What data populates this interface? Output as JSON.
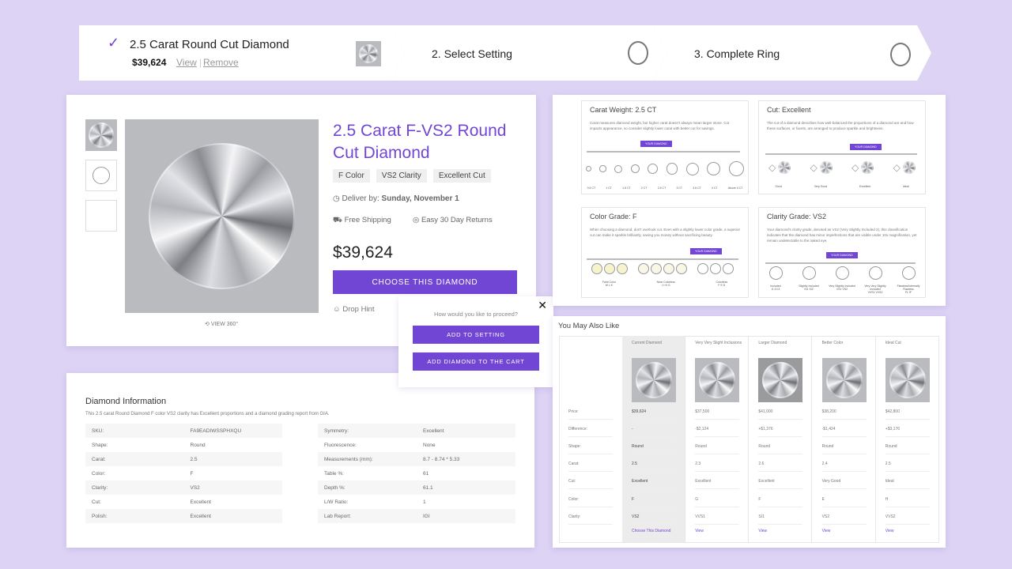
{
  "steps": [
    {
      "title": "2.5 Carat Round Cut Diamond",
      "price": "$39,624",
      "view": "View",
      "remove": "Remove",
      "icon": "check-icon"
    },
    {
      "title": "2. Select Setting",
      "icon": "ring-icon"
    },
    {
      "title": "3. Complete Ring",
      "icon": "diamond-ring-icon"
    }
  ],
  "product": {
    "title": "2.5 Carat F-VS2 Round Cut Diamond",
    "tags": [
      "F Color",
      "VS2 Clarity",
      "Excellent Cut"
    ],
    "deliver_label": "Deliver by:",
    "deliver_date": "Sunday, November 1",
    "shipping": "Free Shipping",
    "returns": "Easy 30 Day Returns",
    "price": "$39,624",
    "choose": "CHOOSE THIS DIAMOND",
    "drop_hint": "Drop Hint",
    "view360": "VIEW 360°",
    "accent": "#7246d4"
  },
  "popup": {
    "question": "How would you like to proceed?",
    "add_setting": "ADD TO SETTING",
    "add_cart": "ADD DIAMOND TO THE CART"
  },
  "info": {
    "title": "Diamond Information",
    "desc": "This 2.5 carat Round Diamond F color VS2 clarity has Excellent proportions and a diamond grading report from GIA.",
    "left": [
      [
        "SKU:",
        "FA9EADIWSSPHXQU"
      ],
      [
        "Shape:",
        "Round"
      ],
      [
        "Carat:",
        "2.5"
      ],
      [
        "Color:",
        "F"
      ],
      [
        "Clarity:",
        "VS2"
      ],
      [
        "Cut:",
        "Excellent"
      ],
      [
        "Polish:",
        "Excellent"
      ]
    ],
    "right": [
      [
        "Symmetry:",
        "Excellent"
      ],
      [
        "Fluorescence:",
        "None"
      ],
      [
        "Measurements (mm):",
        "8.7 - 8.74 * 5.33"
      ],
      [
        "Table %:",
        "61"
      ],
      [
        "Depth %:",
        "61.1"
      ],
      [
        "L/W Ratio:",
        "1"
      ],
      [
        "Lab Report:",
        "IGI"
      ]
    ]
  },
  "guides": {
    "your_diamond": "YOUR DIAMOND",
    "carat": {
      "title": "Carat Weight: 2.5 CT",
      "text": "Carat measures diamond weight, but higher carat doesn't always mean larger stone. Cut impacts appearance, so consider slightly lower carat with better cut for savings.",
      "labels": [
        "0.5 CT",
        "1 CT",
        "1.5 CT",
        "2 CT",
        "2.5 CT",
        "3 CT",
        "3.5 CT",
        "4 CT",
        "Above 4 CT"
      ]
    },
    "cut": {
      "title": "Cut: Excellent",
      "text": "The cut of a diamond describes how well-balanced the proportions of a diamond are and how these surfaces, or facets, are arranged to produce sparkle and brightness.",
      "labels": [
        "Good",
        "Very Good",
        "Excellent",
        "Ideal"
      ]
    },
    "color": {
      "title": "Color Grade: F",
      "text": "When choosing a diamond, don't overlook cut. Even with a slightly lower color grade, a superior cut can make it sparkle brilliantly, saving you money without sacrificing beauty.",
      "labels": [
        [
          "Faint Color",
          "M L K"
        ],
        [
          "Near Colorless",
          "J I H G"
        ],
        [
          "Colorless",
          "F E D"
        ]
      ]
    },
    "clarity": {
      "title": "Clarity Grade: VS2",
      "text": "Your diamond's clarity grade, denoted as VS2 (Very Slightly Included 2), this classification indicates that the diamond has minor imperfections that are visible under 10x magnification, yet remain undetectable to the naked eye.",
      "labels": [
        [
          "Included",
          "I1 I2 I3"
        ],
        [
          "Slightly Included",
          "SI1 SI2"
        ],
        [
          "Very Slightly Included",
          "VS1 VS2"
        ],
        [
          "Very Very Slightly Included",
          "VVS1 VVS2"
        ],
        [
          "Flawless/Internally Flawless",
          "FL IF"
        ]
      ]
    }
  },
  "compare": {
    "title": "You May Also Like",
    "row_labels": [
      "Price:",
      "Difference:",
      "Shape:",
      "Carat:",
      "Cut:",
      "Color:",
      "Clarity:"
    ],
    "columns": [
      {
        "name": "Current Diamond",
        "values": [
          "$39,624",
          "-",
          "Round",
          "2.5",
          "Excellent",
          "F",
          "VS2"
        ],
        "link": "Choose This Diamond"
      },
      {
        "name": "Very Very Slight Inclusions",
        "values": [
          "$37,500",
          "-$2,124",
          "Round",
          "2.3",
          "Excellent",
          "G",
          "VVS1"
        ],
        "link": "View"
      },
      {
        "name": "Larger Diamond",
        "values": [
          "$41,000",
          "+$1,376",
          "Round",
          "2.6",
          "Excellent",
          "F",
          "SI1"
        ],
        "link": "View"
      },
      {
        "name": "Better Color",
        "values": [
          "$38,200",
          "-$1,424",
          "Round",
          "2.4",
          "Very Good",
          "E",
          "VS2"
        ],
        "link": "View"
      },
      {
        "name": "Ideal Cut",
        "values": [
          "$42,800",
          "+$3,176",
          "Round",
          "2.5",
          "Ideal",
          "H",
          "VVS2"
        ],
        "link": "View"
      }
    ]
  }
}
